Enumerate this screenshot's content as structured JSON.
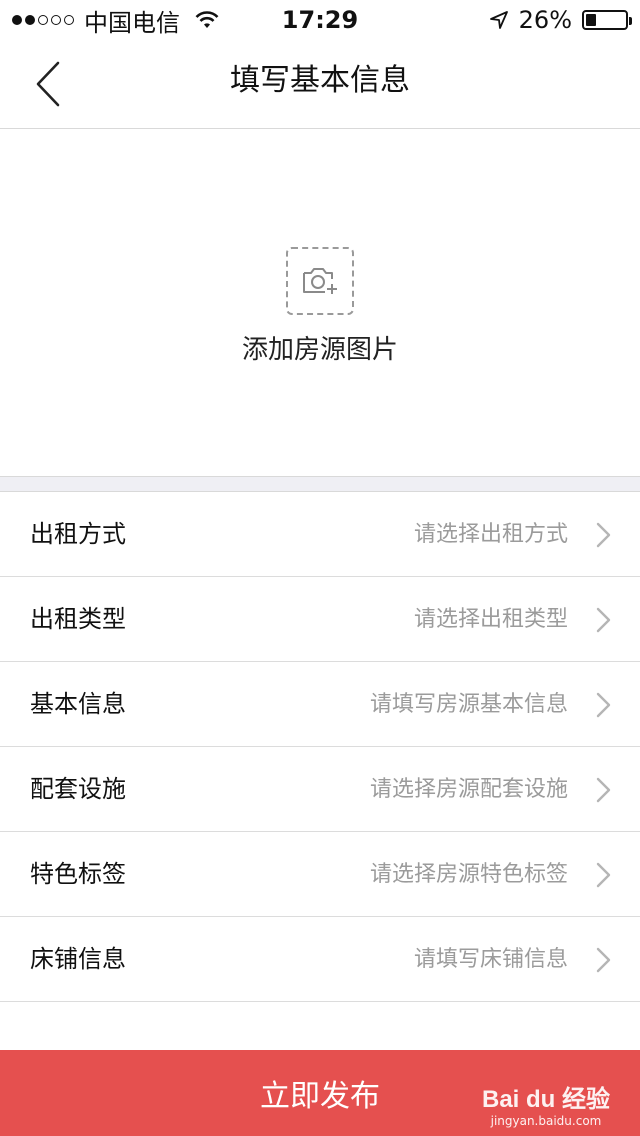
{
  "status_bar": {
    "carrier": "中国电信",
    "time": "17:29",
    "battery_percent_text": "26%",
    "battery_level": 0.26
  },
  "header": {
    "title": "填写基本信息"
  },
  "photo": {
    "label": "添加房源图片"
  },
  "form_rows": [
    {
      "label": "出租方式",
      "hint": "请选择出租方式"
    },
    {
      "label": "出租类型",
      "hint": "请选择出租类型"
    },
    {
      "label": "基本信息",
      "hint": "请填写房源基本信息"
    },
    {
      "label": "配套设施",
      "hint": "请选择房源配套设施"
    },
    {
      "label": "特色标签",
      "hint": "请选择房源特色标签"
    },
    {
      "label": "床铺信息",
      "hint": "请填写床铺信息"
    }
  ],
  "footer": {
    "publish_label": "立即发布"
  },
  "watermark": {
    "logo": "Bai du 经验",
    "url": "jingyan.baidu.com"
  },
  "colors": {
    "accent": "#e5504f",
    "hint_text": "#9b9b9b",
    "divider": "#dcdcdc"
  }
}
